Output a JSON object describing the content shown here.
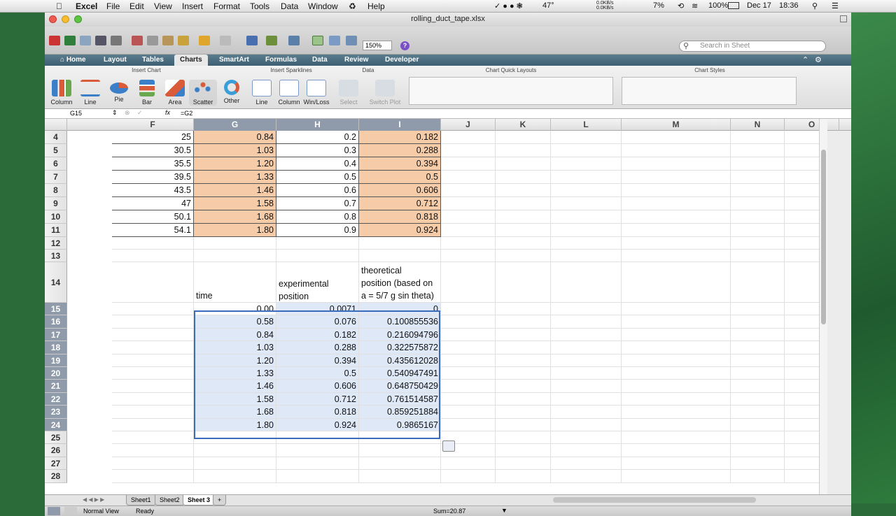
{
  "menubar": {
    "app": "Excel",
    "items": [
      "File",
      "Edit",
      "View",
      "Insert",
      "Format",
      "Tools",
      "Data",
      "Window",
      "Help"
    ],
    "status": {
      "temp": "47°",
      "net_up": "0.0KB/s",
      "net_down": "0.0KB/s",
      "pct": "7%",
      "battery": "100%",
      "date": "Dec 17",
      "time": "18:36"
    }
  },
  "window": {
    "title": "rolling_duct_tape.xlsx",
    "zoom": "150%",
    "search_placeholder": "Search in Sheet"
  },
  "tabs": [
    "Home",
    "Layout",
    "Tables",
    "Charts",
    "SmartArt",
    "Formulas",
    "Data",
    "Review",
    "Developer"
  ],
  "ribbon": {
    "groups": {
      "insert_chart": "Insert Chart",
      "sparklines": "Insert Sparklines",
      "data": "Data",
      "quick_layouts": "Chart Quick Layouts",
      "styles": "Chart Styles"
    },
    "chart_buttons": [
      "Column",
      "Line",
      "Pie",
      "Bar",
      "Area",
      "Scatter",
      "Other"
    ],
    "sparkline_buttons": [
      "Line",
      "Column",
      "Win/Loss"
    ],
    "data_buttons": [
      "Select",
      "Switch Plot"
    ]
  },
  "formula": {
    "name_box": "G15",
    "content": "=G2",
    "fx": "fx"
  },
  "columns": [
    "F",
    "G",
    "H",
    "I",
    "J",
    "K",
    "L",
    "M",
    "N",
    "O"
  ],
  "rows": {
    "upper": [
      {
        "n": "4",
        "f": "25",
        "g": "0.84",
        "h": "0.2",
        "i": "0.182"
      },
      {
        "n": "5",
        "f": "30.5",
        "g": "1.03",
        "h": "0.3",
        "i": "0.288"
      },
      {
        "n": "6",
        "f": "35.5",
        "g": "1.20",
        "h": "0.4",
        "i": "0.394"
      },
      {
        "n": "7",
        "f": "39.5",
        "g": "1.33",
        "h": "0.5",
        "i": "0.5"
      },
      {
        "n": "8",
        "f": "43.5",
        "g": "1.46",
        "h": "0.6",
        "i": "0.606"
      },
      {
        "n": "9",
        "f": "47",
        "g": "1.58",
        "h": "0.7",
        "i": "0.712"
      },
      {
        "n": "10",
        "f": "50.1",
        "g": "1.68",
        "h": "0.8",
        "i": "0.818"
      },
      {
        "n": "11",
        "f": "54.1",
        "g": "1.80",
        "h": "0.9",
        "i": "0.924"
      }
    ],
    "blank_a": [
      "12",
      "13"
    ],
    "header": {
      "n": "14",
      "g": "time",
      "h_lines": [
        "experimental",
        "position"
      ],
      "i_lines": [
        "theoretical",
        "position (based on",
        "a = 5/7 g sin theta)"
      ]
    },
    "lower": [
      {
        "n": "15",
        "g": "0.00",
        "h": "0.0071",
        "i": "0"
      },
      {
        "n": "16",
        "g": "0.58",
        "h": "0.076",
        "i": "0.100855536"
      },
      {
        "n": "17",
        "g": "0.84",
        "h": "0.182",
        "i": "0.216094796"
      },
      {
        "n": "18",
        "g": "1.03",
        "h": "0.288",
        "i": "0.322575872"
      },
      {
        "n": "19",
        "g": "1.20",
        "h": "0.394",
        "i": "0.435612028"
      },
      {
        "n": "20",
        "g": "1.33",
        "h": "0.5",
        "i": "0.540947491"
      },
      {
        "n": "21",
        "g": "1.46",
        "h": "0.606",
        "i": "0.648750429"
      },
      {
        "n": "22",
        "g": "1.58",
        "h": "0.712",
        "i": "0.761514587"
      },
      {
        "n": "23",
        "g": "1.68",
        "h": "0.818",
        "i": "0.859251884"
      },
      {
        "n": "24",
        "g": "1.80",
        "h": "0.924",
        "i": "0.9865167"
      }
    ],
    "blank_b": [
      "25",
      "26",
      "27",
      "28"
    ]
  },
  "sheets": [
    "Sheet1",
    "Sheet2",
    "Sheet 3",
    "+"
  ],
  "status": {
    "view": "Normal View",
    "state": "Ready",
    "sum": "Sum=20.87"
  },
  "colors": {
    "orange_fill": "#f6cba8",
    "selection_fill": "#dee8f6",
    "selection_border": "#3b6bbd",
    "tab_bar": "#3d5f72"
  }
}
